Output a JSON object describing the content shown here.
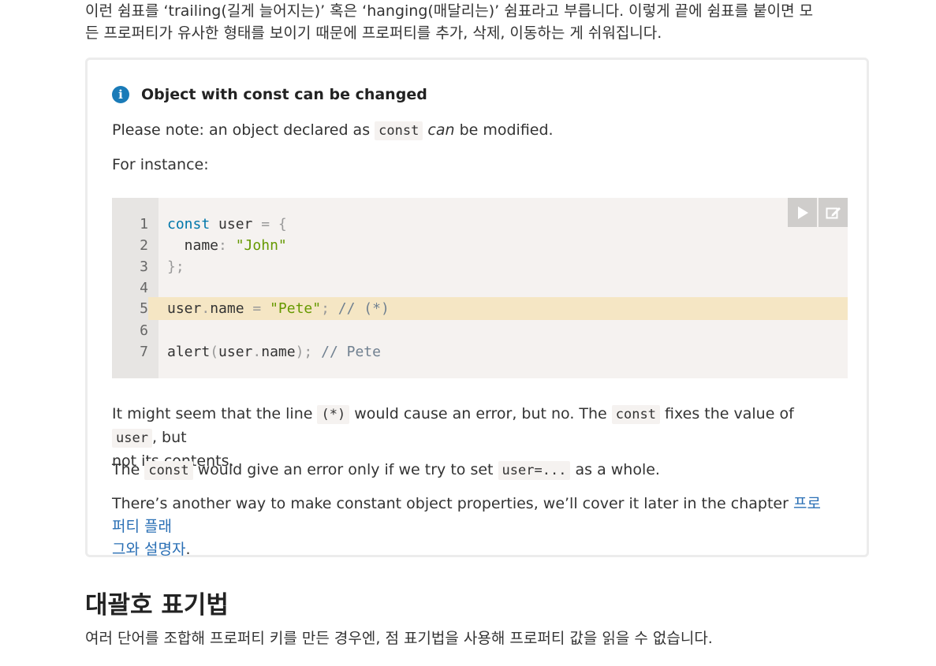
{
  "intro": {
    "line1": "이런 쉼표를 ‘trailing(길게 늘어지는)’ 혹은 ‘hanging(매달리는)’ 쉼표라고 부릅니다. 이렇게 끝에 쉼표를 붙이면 모",
    "line2": "든 프로퍼티가 유사한 형태를 보이기 때문에 프로퍼티를 추가, 삭제, 이동하는 게 쉬워집니다."
  },
  "infobox": {
    "icon": "info-icon",
    "title": "Object with const can be changed",
    "note_pre": "Please note: an object declared as",
    "note_code": "const",
    "note_em": "can",
    "note_post": "be modified.",
    "instance": "For instance:",
    "p1_a": "It might seem that the line",
    "p1_code1": "(*)",
    "p1_b": "would cause an error, but no. The",
    "p1_code2": "const",
    "p1_c": "fixes the value of",
    "p1_code3": "user",
    "p1_d": ", but",
    "p1_e": "not its contents.",
    "p2_a": "The",
    "p2_code1": "const",
    "p2_b": "would give an error only if we try to set",
    "p2_code2": "user=...",
    "p2_c": "as a whole.",
    "p3_a": "There’s another way to make constant object properties, we’ll cover it later in the chapter",
    "p3_link1": "프로퍼티 플래",
    "p3_link2": "그와 설명자",
    "p3_end": "."
  },
  "code": {
    "line_numbers": [
      "1",
      "2",
      "3",
      "4",
      "5",
      "6",
      "7"
    ],
    "highlighted_line": 5,
    "run_button_icon": "play-icon",
    "edit_button_icon": "edit-icon"
  },
  "section": {
    "heading": "대괄호 표기법",
    "text": "여러 단어를 조합해 프로퍼티 키를 만든 경우엔, 점 표기법을 사용해 프로퍼티 값을 읽을 수 없습니다."
  }
}
